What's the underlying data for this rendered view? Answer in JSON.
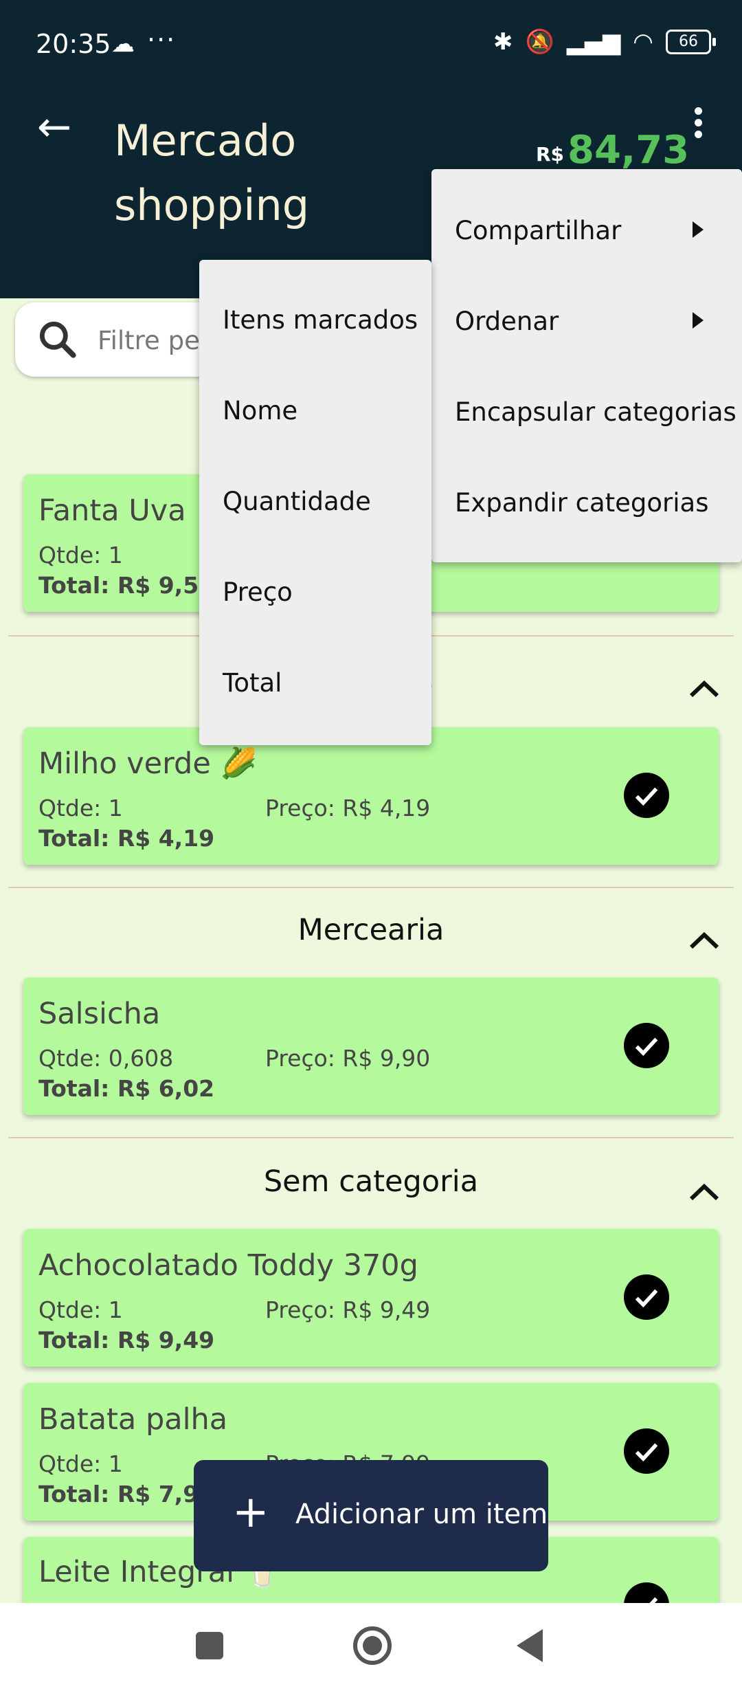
{
  "status_bar": {
    "time": "20:35",
    "dots": "···",
    "battery": "66"
  },
  "header": {
    "title": "Mercado shopping",
    "currency": "R$",
    "total": "84,73"
  },
  "search": {
    "placeholder": "Filtre pelo"
  },
  "items": [
    {
      "name": "Fanta Uva",
      "qty": "Qtde: 1",
      "price": "",
      "total": "Total: R$ 9,59"
    },
    {
      "name": "Milho verde 🌽",
      "qty": "Qtde: 1",
      "price": "Preço: R$ 4,19",
      "total": "Total: R$ 4,19"
    },
    {
      "name": "Salsicha",
      "qty": "Qtde: 0,608",
      "price": "Preço: R$ 9,90",
      "total": "Total: R$ 6,02"
    },
    {
      "name": "Achocolatado Toddy 370g",
      "qty": "Qtde: 1",
      "price": "Preço: R$ 9,49",
      "total": "Total: R$ 9,49"
    },
    {
      "name": "Batata palha",
      "qty": "Qtde: 1",
      "price": "Preço: R$ 7,99",
      "total": "Total: R$ 7,99"
    },
    {
      "name": "Leite Integral 🥛",
      "qty": "",
      "price": "",
      "total": ""
    }
  ],
  "categories": {
    "hortifruti_partial": "s",
    "mercearia": "Mercearia",
    "sem_categoria": "Sem categoria"
  },
  "menu_main": [
    {
      "label": "Compartilhar"
    },
    {
      "label": "Ordenar"
    },
    {
      "label": "Encapsular categorias"
    },
    {
      "label": "Expandir categorias"
    }
  ],
  "menu_sort": [
    {
      "label": "Itens marcados"
    },
    {
      "label": "Nome"
    },
    {
      "label": "Quantidade"
    },
    {
      "label": "Preço"
    },
    {
      "label": "Total"
    }
  ],
  "fab": {
    "label": "Adicionar um item"
  },
  "colors": {
    "header_bg": "#0d2530",
    "total_green": "#56c15b",
    "card_bg": "#b4f99b",
    "page_bg": "#eef8dc",
    "fab_bg": "#1e2b4a"
  }
}
